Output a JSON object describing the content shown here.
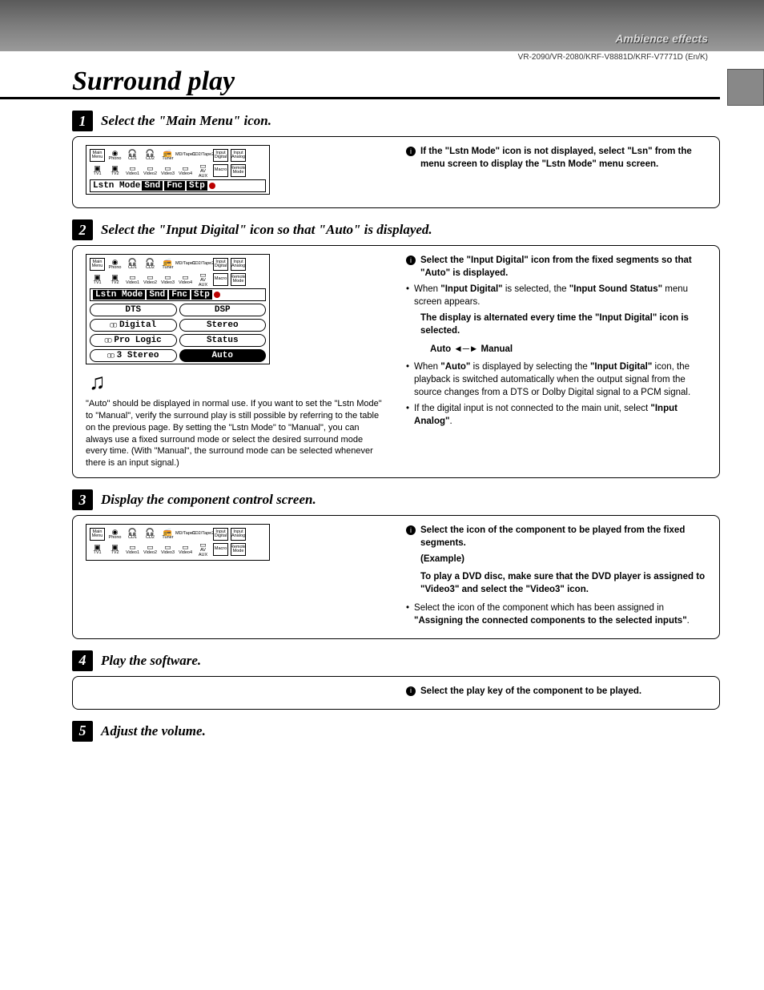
{
  "header": {
    "ambience_label": "Ambience effects",
    "models": "VR-2090/VR-2080/KRF-V8881D/KRF-V7771D (En/K)"
  },
  "page_title": "Surround play",
  "osd_icons": {
    "row1": [
      "Main Menu",
      "Phono",
      "CD1",
      "CD2",
      "Tuner",
      "MD/Tape1",
      "CD2/Tape2",
      "Input Digital",
      "Input Analog"
    ],
    "row2": [
      "TV1",
      "TV2",
      "Video1",
      "Video2",
      "Video3",
      "Video4",
      "AV AUX",
      "Macro",
      "Remote Mode"
    ]
  },
  "menubar": {
    "lstn": "Lstn Mode",
    "snd": "Snd",
    "fnc": "Fnc",
    "stp": "Stp"
  },
  "options": {
    "dts": "DTS",
    "dsp": "DSP",
    "digital": "Digital",
    "stereo": "Stereo",
    "prologic": "Pro Logic",
    "status": "Status",
    "three_stereo": "3 Stereo",
    "auto": "Auto"
  },
  "steps": {
    "s1": {
      "title": "Select the \"Main Menu\" icon.",
      "tip_b1": "If the \"Lstn Mode\" icon is not displayed, select \"Lsn\" from the menu screen to display the \"Lstn Mode\" menu screen."
    },
    "s2": {
      "title": "Select the \"Input Digital\" icon so that \"Auto\" is displayed.",
      "note_para": "\"Auto\" should be displayed in normal use. If you want to set the \"Lstn Mode\" to \"Manual\", verify the surround play is still possible by referring to the table on the previous page. By setting the \"Lstn Mode\" to \"Manual\", you can always use a fixed surround mode or select the desired surround mode every time. (With \"Manual\", the surround mode can be selected whenever there is an input signal.)",
      "r_b1": "Select the \"Input Digital\" icon from the fixed segments so that \"Auto\" is displayed.",
      "r_p1a": "When ",
      "r_p1b": "\"Input Digital\"",
      "r_p1c": " is selected, the ",
      "r_p1d": "\"Input Sound Status\"",
      "r_p1e": " menu screen appears.",
      "r_p2": "The display is alternated every time the \"Input Digital\" icon is selected.",
      "r_arrow": "Auto ◄─► Manual",
      "r_p3a": "When ",
      "r_p3b": "\"Auto\"",
      "r_p3c": " is displayed by selecting the ",
      "r_p3d": "\"Input Digital\"",
      "r_p3e": " icon, the playback is switched automatically when the output signal from the source changes from a DTS or Dolby Digital signal to a PCM signal.",
      "r_p4a": "If the digital input is not connected to the main unit, select ",
      "r_p4b": "\"Input Analog\"",
      "r_p4c": "."
    },
    "s3": {
      "title": "Display the component control screen.",
      "r_b1": "Select the icon of the component to be played from the fixed segments.",
      "r_ex_label": "(Example)",
      "r_ex": "To play a DVD disc, make sure that the DVD player is assigned to \"Video3\" and select the \"Video3\" icon.",
      "r_p1a": "Select the icon of the component which has been assigned in ",
      "r_p1b": "\"Assigning the connected components to the selected inputs\"",
      "r_p1c": "."
    },
    "s4": {
      "title": "Play the software.",
      "r_b1": "Select the play key of the component to be played."
    },
    "s5": {
      "title": "Adjust the volume."
    }
  },
  "nums": {
    "n1": "1",
    "n2": "2",
    "n3": "3",
    "n4": "4",
    "n5": "5"
  }
}
